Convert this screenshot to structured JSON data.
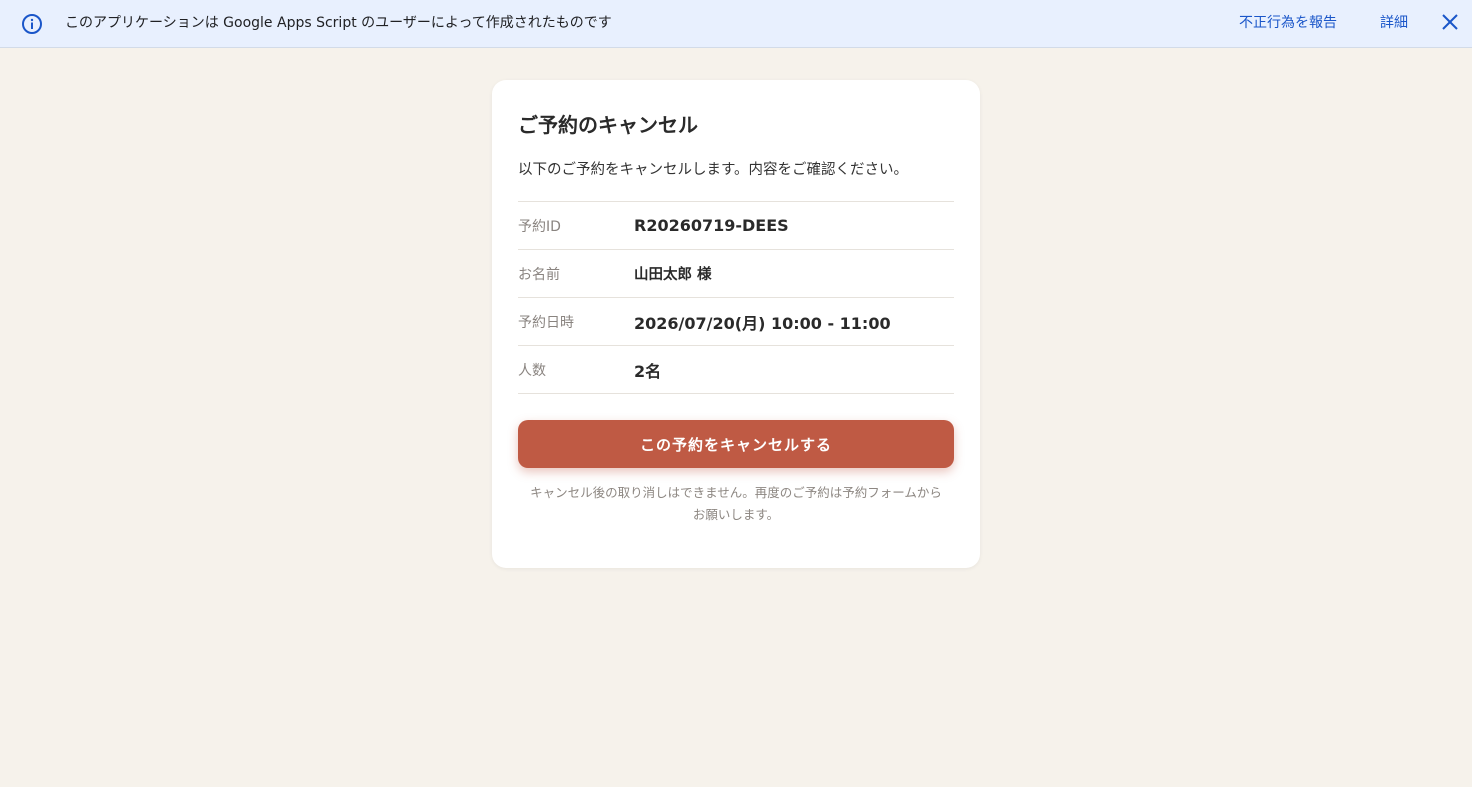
{
  "banner": {
    "icon": "info-icon",
    "message": "このアプリケーションは Google Apps Script のユーザーによって作成されたものです",
    "report_link": "不正行為を報告",
    "details_link": "詳細",
    "close_icon": "close-icon",
    "accent_color": "#1a56c9",
    "background_color": "#e8f0fe"
  },
  "card": {
    "title": "ご予約のキャンセル",
    "lead": "以下のご予約をキャンセルします。内容をご確認ください。",
    "rows": [
      {
        "label": "予約ID",
        "value": "R20260719-DEES"
      },
      {
        "label": "お名前",
        "value": "山田太郎 様"
      },
      {
        "label": "予約日時",
        "value": "2026/07/20(月) 10:00 - 11:00"
      },
      {
        "label": "人数",
        "value": "2名"
      }
    ],
    "cancel_button": "この予約をキャンセルする",
    "cancel_button_color": "#bf5a44",
    "note_line1": "キャンセル後の取り消しはできません。再度のご予約は予約フォームから",
    "note_line2": "お願いします。"
  },
  "page_background": "#f6f2eb"
}
